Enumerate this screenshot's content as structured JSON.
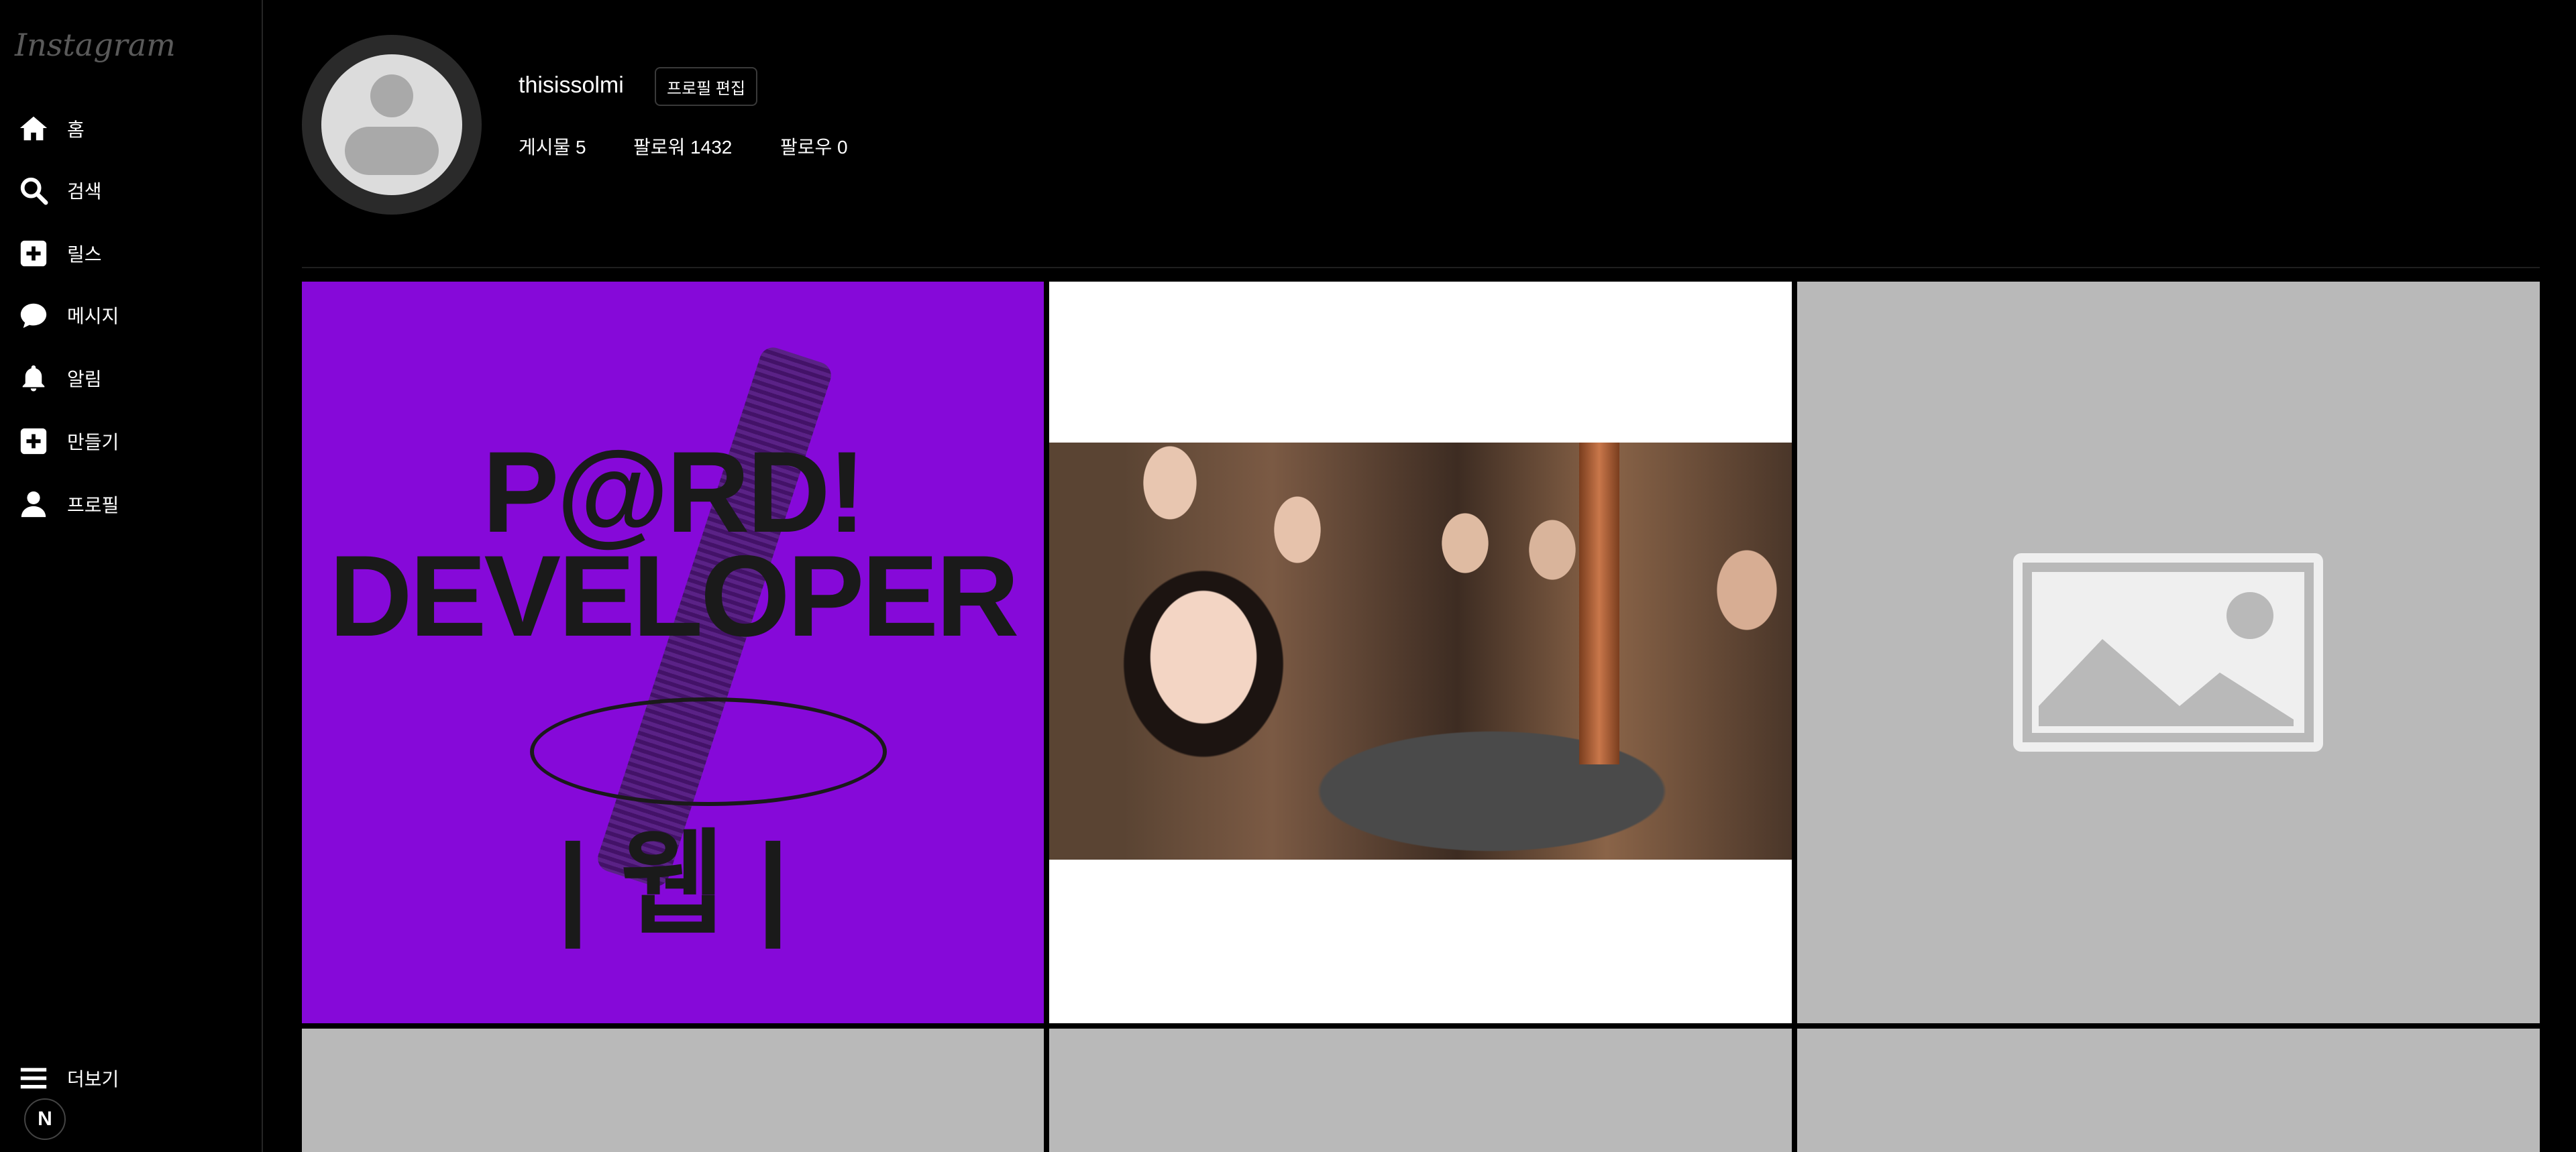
{
  "app": {
    "logo_text": "Instagram"
  },
  "sidebar": {
    "items": [
      {
        "label": "홈",
        "icon": "home-icon"
      },
      {
        "label": "검색",
        "icon": "search-icon"
      },
      {
        "label": "릴스",
        "icon": "plus-square-icon"
      },
      {
        "label": "메시지",
        "icon": "chat-bubble-icon"
      },
      {
        "label": "알림",
        "icon": "bell-icon"
      },
      {
        "label": "만들기",
        "icon": "plus-square-icon"
      },
      {
        "label": "프로필",
        "icon": "user-icon"
      }
    ],
    "more_label": "더보기",
    "badge_text": "N"
  },
  "profile": {
    "username": "thisissolmi",
    "edit_label": "프로필 편집",
    "stats": {
      "posts": "게시물 5",
      "followers": "팔로워 1432",
      "following": "팔로우 0"
    }
  },
  "posts": [
    {
      "type": "poster",
      "lines": [
        "P@RD!",
        "DEVELOPER",
        "| 웹 |"
      ],
      "bg": "#8609d9"
    },
    {
      "type": "photo",
      "desc_icon": "group-photo"
    },
    {
      "type": "placeholder",
      "icon": "image-placeholder-icon"
    },
    {
      "type": "placeholder"
    },
    {
      "type": "placeholder"
    },
    {
      "type": "placeholder"
    }
  ],
  "colors": {
    "background": "#000000",
    "placeholder": "#b9b9b9",
    "poster_purple": "#8609d9"
  }
}
